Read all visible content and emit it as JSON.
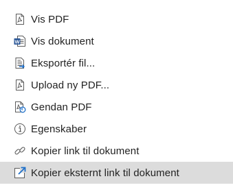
{
  "menu": {
    "items": [
      {
        "label": "Vis PDF",
        "icon": "pdf-icon"
      },
      {
        "label": "Vis dokument",
        "icon": "word-document-icon"
      },
      {
        "label": "Eksportér fil...",
        "icon": "export-file-icon"
      },
      {
        "label": "Upload ny PDF...",
        "icon": "pdf-upload-icon"
      },
      {
        "label": "Gendan PDF",
        "icon": "pdf-restore-icon"
      },
      {
        "label": "Egenskaber",
        "icon": "info-icon"
      },
      {
        "label": "Kopier link til dokument",
        "icon": "link-icon"
      },
      {
        "label": "Kopier eksternt link til dokument",
        "icon": "external-link-icon"
      }
    ],
    "highlighted_index": 7
  },
  "colors": {
    "text": "#222222",
    "icon_stroke": "#5a5a5a",
    "word_blue": "#2b5797",
    "accent_blue": "#1e6fc9",
    "hover_background": "#dcdcdc"
  }
}
